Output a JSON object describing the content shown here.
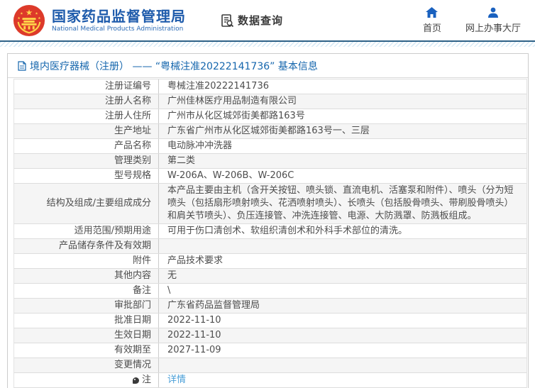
{
  "header": {
    "agency_cn": "国家药品监督管理局",
    "agency_en": "National Medical Products Administration",
    "data_query_label": "数据查询",
    "nav": [
      {
        "label": "首页",
        "icon": "home-icon"
      },
      {
        "label": "网上办事大厅",
        "icon": "person-icon"
      }
    ]
  },
  "page": {
    "title": "境内医疗器械（注册） —— “粤械注准20222141736” 基本信息"
  },
  "table": {
    "rows": [
      {
        "label": "注册证编号",
        "value": "粤械注准20222141736"
      },
      {
        "label": "注册人名称",
        "value": "广州佳林医疗用品制造有限公司"
      },
      {
        "label": "注册人住所",
        "value": "广州市从化区城郊街美都路163号"
      },
      {
        "label": "生产地址",
        "value": "广东省广州市从化区城郊街美都路163号一、三层"
      },
      {
        "label": "产品名称",
        "value": "电动脉冲冲洗器"
      },
      {
        "label": "管理类别",
        "value": "第二类"
      },
      {
        "label": "型号规格",
        "value": "W-206A、W-206B、W-206C"
      },
      {
        "label": "结构及组成/主要组成成分",
        "value": "本产品主要由主机（含开关按钮、喷头锁、直流电机、活塞泵和附件）、喷头（分为短喷头（包括扇形喷射喷头、花洒喷射喷头）、长喷头（包括股骨喷头、带刷股骨喷头）和肩关节喷头）、负压连接管、冲洗连接管、电源、大防溅罩、防溅板组成。"
      },
      {
        "label": "适用范围/预期用途",
        "value": "可用于伤口清创术、软组织清创术和外科手术部位的清洗。"
      },
      {
        "label": "产品储存条件及有效期",
        "value": ""
      },
      {
        "label": "附件",
        "value": "产品技术要求"
      },
      {
        "label": "其他内容",
        "value": "无"
      },
      {
        "label": "备注",
        "value": "\\"
      },
      {
        "label": "审批部门",
        "value": "广东省药品监督管理局"
      },
      {
        "label": "批准日期",
        "value": "2022-11-10"
      },
      {
        "label": "生效日期",
        "value": "2022-11-10"
      },
      {
        "label": "有效期至",
        "value": "2027-11-09"
      },
      {
        "label": "变更情况",
        "value": ""
      },
      {
        "label": "注",
        "value": "详情",
        "type": "link",
        "icon": "note-icon"
      }
    ]
  },
  "colors": {
    "brand_blue": "#1e5bab",
    "nav_icon_blue": "#1a61bf",
    "title_blue": "#1566ad",
    "link_blue": "#4a9fd8",
    "divider_line": "#2e6187",
    "stripe_blue": "#d8eaf6",
    "row_alt_gray": "#f5f5f5",
    "emblem_red": "#dd3a2a",
    "emblem_gold": "#ffd54a"
  }
}
